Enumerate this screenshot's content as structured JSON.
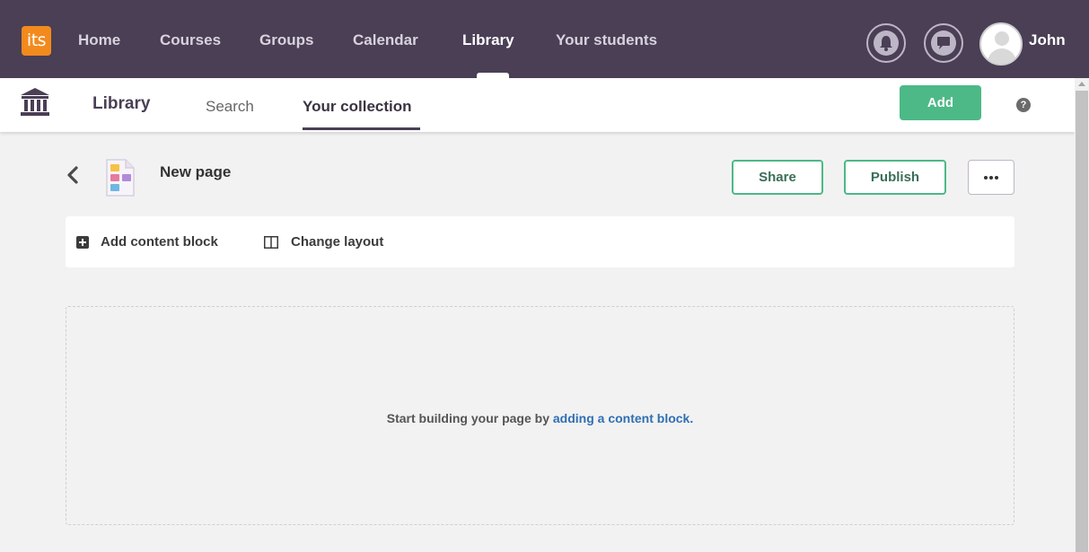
{
  "topnav": {
    "logo": "its",
    "links": [
      "Home",
      "Courses",
      "Groups",
      "Calendar",
      "Library",
      "Your students"
    ],
    "active": "Library",
    "user": "John"
  },
  "subnav": {
    "title": "Library",
    "tabs": [
      "Search",
      "Your collection"
    ],
    "active_tab": "Your collection",
    "add_label": "Add",
    "help_symbol": "?"
  },
  "page": {
    "title": "New page",
    "share_label": "Share",
    "publish_label": "Publish"
  },
  "toolbar": {
    "add_block": "Add content block",
    "change_layout": "Change layout"
  },
  "dropzone": {
    "text": "Start building your page by ",
    "link": "adding a content block."
  },
  "colors": {
    "nav_bg": "#4a3f55",
    "accent_green": "#4cb987",
    "logo_orange": "#f28a1d",
    "link_blue": "#2f6fb3"
  }
}
